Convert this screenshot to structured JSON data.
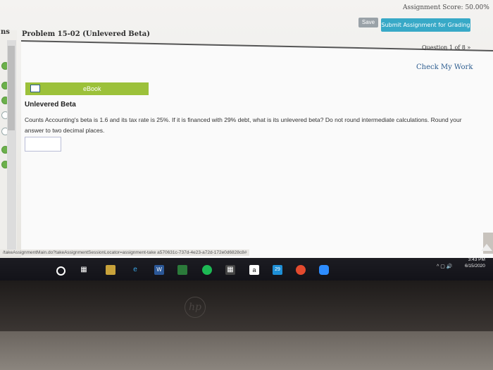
{
  "header": {
    "assignment_score": "Assignment Score: 50.00%",
    "save_label": "Save",
    "submit_label": "Submit Assignment for Grading"
  },
  "sidebar": {
    "partial_label": "ns"
  },
  "problem": {
    "title": "Problem 15-02 (Unlevered Beta)",
    "question_nav": "Question 1 of 8 »",
    "check_work": "Check My Work",
    "ebook_label": "eBook",
    "heading": "Unlevered Beta",
    "text": "Counts Accounting's beta is 1.6 and its tax rate is 25%. If it is financed with 29% debt, what is its unlevered beta? Do not round intermediate calculations. Round your answer to two decimal places.",
    "answer_value": ""
  },
  "status_url": "/takeAssignmentMain.do?takeAssignmentSessionLocator=assignment-take a570631c-737d-4e23-a72d-172e0d6828c8#",
  "taskbar": {
    "time": "3:43 PM",
    "date": "6/15/2020",
    "badge_29": "29",
    "amazon_letter": "a"
  },
  "monitor": {
    "brand": "hp"
  }
}
